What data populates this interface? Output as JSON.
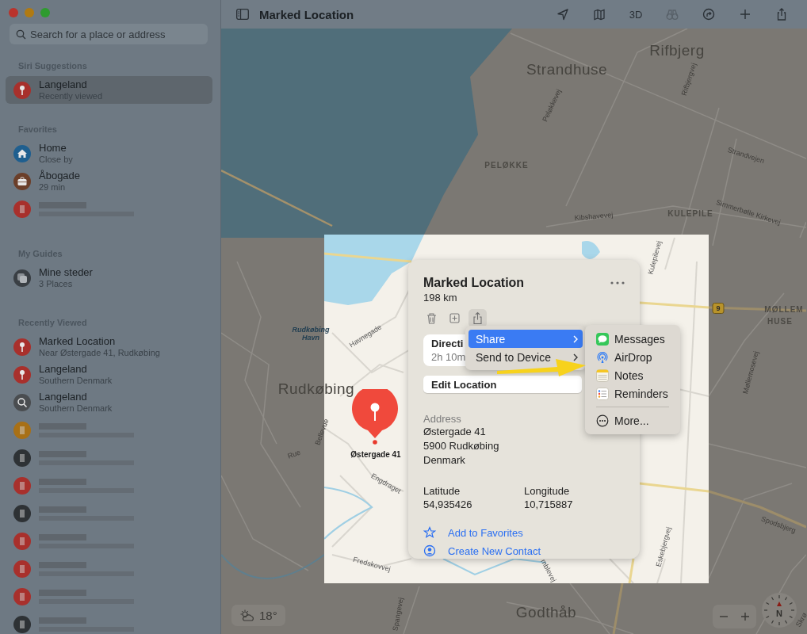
{
  "window": {
    "title": "Marked Location"
  },
  "sidebar": {
    "search": {
      "placeholder": "Search for a place or address"
    },
    "sections": [
      {
        "title": "Siri Suggestions",
        "items": [
          {
            "kind": "pin",
            "color": "#a8302c",
            "title": "Langeland",
            "subtitle": "Recently viewed",
            "selected": true
          }
        ]
      },
      {
        "title": "Favorites",
        "items": [
          {
            "kind": "home",
            "color": "#1f5f8f",
            "title": "Home",
            "subtitle": "Close by",
            "selected": false
          },
          {
            "kind": "work",
            "color": "#6b3f2a",
            "title": "Åbogade",
            "subtitle": "29 min",
            "selected": false
          },
          {
            "kind": "blurred",
            "color": "#a8302c",
            "selected": false
          }
        ]
      },
      {
        "title": "My Guides",
        "items": [
          {
            "kind": "guide",
            "color": "#3a3f44",
            "title": "Mine steder",
            "subtitle": "3 Places",
            "selected": false
          }
        ]
      },
      {
        "title": "Recently Viewed",
        "items": [
          {
            "kind": "pin",
            "color": "#a8302c",
            "title": "Marked Location",
            "subtitle": "Near Østergade 41, Rudkøbing",
            "selected": false
          },
          {
            "kind": "pin",
            "color": "#a8302c",
            "title": "Langeland",
            "subtitle": "Southern Denmark",
            "selected": false
          },
          {
            "kind": "search",
            "color": "#4a4d50",
            "title": "Langeland",
            "subtitle": "Southern Denmark",
            "selected": false
          },
          {
            "kind": "blurred",
            "color": "#a87016",
            "selected": false
          },
          {
            "kind": "blurred",
            "color": "#2e3235",
            "selected": false
          },
          {
            "kind": "blurred",
            "color": "#a8302c",
            "selected": false
          },
          {
            "kind": "blurred",
            "color": "#2e3235",
            "selected": false
          },
          {
            "kind": "blurred",
            "color": "#a8302c",
            "selected": false
          },
          {
            "kind": "blurred",
            "color": "#a8302c",
            "selected": false
          },
          {
            "kind": "blurred",
            "color": "#a8302c",
            "selected": false
          },
          {
            "kind": "blurred",
            "color": "#2e3235",
            "selected": false
          }
        ]
      }
    ]
  },
  "toolbar": {
    "buttons": [
      {
        "kind": "location",
        "disabled": false
      },
      {
        "kind": "map",
        "disabled": false
      },
      {
        "kind": "text",
        "label": "3D",
        "disabled": false
      },
      {
        "kind": "binoculars",
        "disabled": true
      },
      {
        "kind": "route",
        "disabled": false
      },
      {
        "kind": "add",
        "disabled": false
      },
      {
        "kind": "share",
        "disabled": false
      }
    ]
  },
  "map": {
    "labels": [
      {
        "kind": "town",
        "text": "Rifbjerg"
      },
      {
        "kind": "town",
        "text": "Strandhuse"
      },
      {
        "kind": "road",
        "text": "Peløkkevej"
      },
      {
        "kind": "road",
        "text": "Rifbjergvej"
      },
      {
        "kind": "area",
        "text": "PELØKKE"
      },
      {
        "kind": "road",
        "text": "Strandvejen"
      },
      {
        "kind": "area",
        "text": "KULEPILE"
      },
      {
        "kind": "road",
        "text": "Kibshavevej"
      },
      {
        "kind": "road",
        "text": "Simmerbølle Kirkevej"
      },
      {
        "kind": "road",
        "text": "Kulepilevej"
      },
      {
        "kind": "shield",
        "text": "9"
      },
      {
        "kind": "area",
        "text": "MØLLEM"
      },
      {
        "kind": "area",
        "text": "HUSE"
      },
      {
        "kind": "water",
        "text": "Rudkøbing Havn"
      },
      {
        "kind": "road",
        "text": "Havnegade"
      },
      {
        "kind": "town",
        "text": "Rudkøbing"
      },
      {
        "kind": "road",
        "text": "Bellevue"
      },
      {
        "kind": "road",
        "text": "Rue"
      },
      {
        "kind": "pin",
        "text": "Østergade 41"
      },
      {
        "kind": "road",
        "text": "Møllemosevej"
      },
      {
        "kind": "road",
        "text": "Engdraget"
      },
      {
        "kind": "road",
        "text": "Spodsbjerg"
      },
      {
        "kind": "road",
        "text": "Fredskovvej"
      },
      {
        "kind": "road",
        "text": "mblevej"
      },
      {
        "kind": "road",
        "text": "Eskebjergvej"
      },
      {
        "kind": "road",
        "text": "Spangevej"
      },
      {
        "kind": "town",
        "text": "Godthåb"
      },
      {
        "kind": "road",
        "text": "Skrø"
      }
    ],
    "weather": {
      "temperature": "18°"
    },
    "compass": {
      "label": "N"
    }
  },
  "place_card": {
    "title": "Marked Location",
    "distance": "198 km",
    "actions": [
      {
        "kind": "trash",
        "selected": false
      },
      {
        "kind": "add",
        "selected": false
      },
      {
        "kind": "share",
        "selected": true
      }
    ],
    "directions": {
      "label": "Directi",
      "time": "2h 10m"
    },
    "edit_button": "Edit Location",
    "address": {
      "label": "Address",
      "lines": [
        "Østergade 41",
        "5900 Rudkøbing",
        "Denmark"
      ]
    },
    "coordinates": [
      {
        "label": "Latitude",
        "value": "54,935426"
      },
      {
        "label": "Longitude",
        "value": "10,715887"
      }
    ],
    "links": [
      {
        "kind": "star",
        "label": "Add to Favorites"
      },
      {
        "kind": "contact",
        "label": "Create New Contact"
      }
    ]
  },
  "context_menu": {
    "items": [
      {
        "label": "Share",
        "selected": true,
        "submenu": true
      },
      {
        "label": "Send to Device",
        "selected": false,
        "submenu": true
      }
    ]
  },
  "share_menu": {
    "items": [
      {
        "kind": "messages",
        "label": "Messages"
      },
      {
        "kind": "airdrop",
        "label": "AirDrop"
      },
      {
        "kind": "notes",
        "label": "Notes"
      },
      {
        "kind": "reminders",
        "label": "Reminders"
      },
      {
        "kind": "separator"
      },
      {
        "kind": "more",
        "label": "More..."
      }
    ]
  }
}
